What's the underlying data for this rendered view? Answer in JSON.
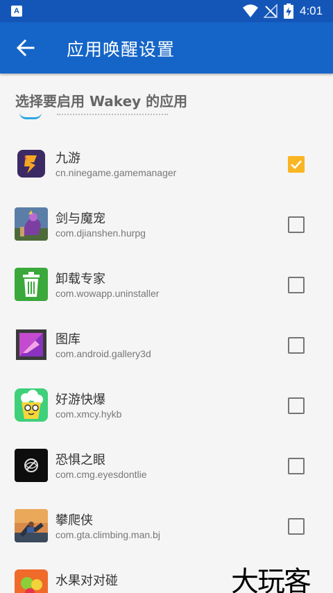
{
  "status_bar": {
    "notification_icon": "A",
    "time": "4:01"
  },
  "app_bar": {
    "title": "应用唤醒设置"
  },
  "section_header": "选择要启用 Wakey 的应用",
  "apps": [
    {
      "name": "九游",
      "package": "cn.ninegame.gamemanager",
      "checked": true,
      "icon": "jiuyou-icon"
    },
    {
      "name": "剑与魔宠",
      "package": "com.djianshen.hurpg",
      "checked": false,
      "icon": "game-character-icon"
    },
    {
      "name": "卸载专家",
      "package": "com.wowapp.uninstaller",
      "checked": false,
      "icon": "trash-can-icon"
    },
    {
      "name": "图库",
      "package": "com.android.gallery3d",
      "checked": false,
      "icon": "gallery-icon"
    },
    {
      "name": "好游快爆",
      "package": "com.xmcy.hykb",
      "checked": false,
      "icon": "popcorn-mascot-icon"
    },
    {
      "name": "恐惧之眼",
      "package": "com.cmg.eyesdontlie",
      "checked": false,
      "icon": "crossed-eye-icon"
    },
    {
      "name": "攀爬侠",
      "package": "com.gta.climbing.man.bj",
      "checked": false,
      "icon": "climbing-man-icon"
    },
    {
      "name": "水果对对碰",
      "package": "",
      "checked": false,
      "icon": "fruit-icon"
    }
  ],
  "watermark": "大玩客",
  "colors": {
    "status_bar": "#1456b8",
    "app_bar": "#1565c8",
    "checkbox_checked": "#f9b522"
  }
}
